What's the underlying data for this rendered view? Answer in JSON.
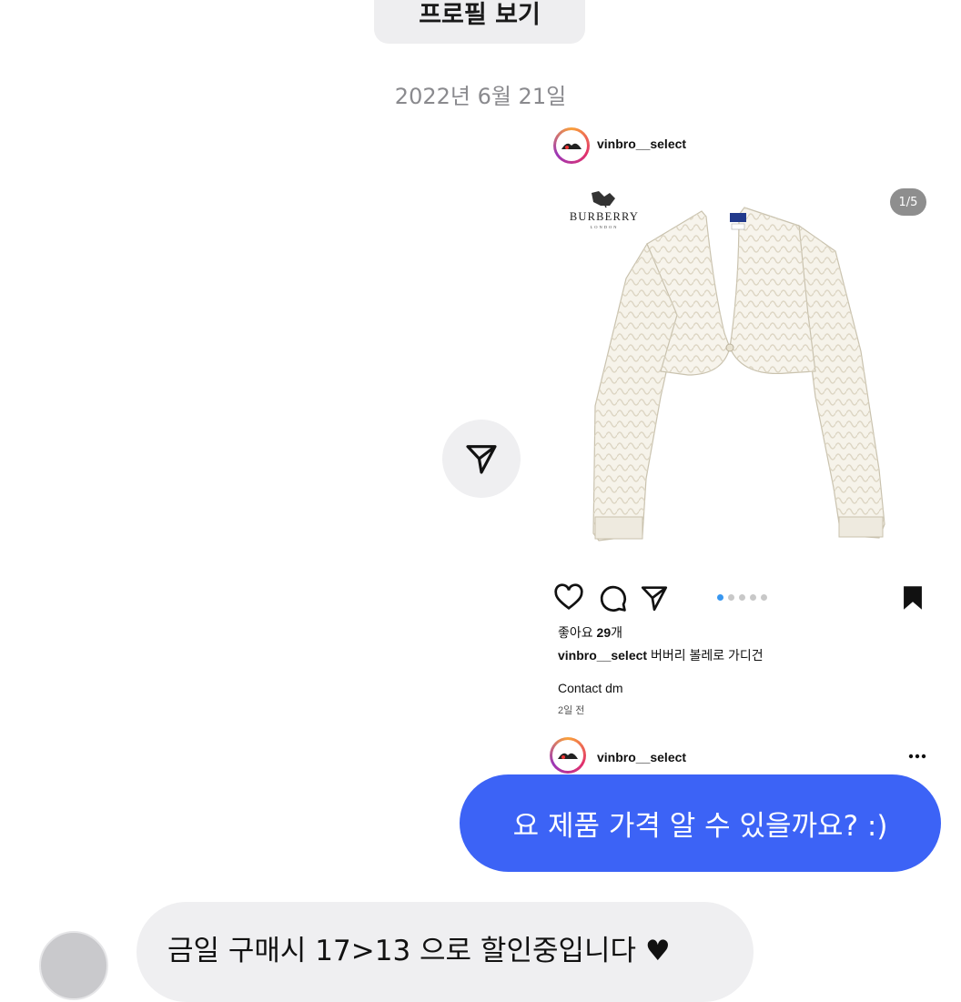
{
  "thread": {
    "profile_button": "프로필 보기",
    "date_separator": "2022년 6월 21일"
  },
  "shared_post": {
    "username": "vinbro__select",
    "image_counter": "1/5",
    "brand_logo_text": "BURBERRY",
    "brand_logo_subtext": "LONDON",
    "carousel_dots": 5,
    "carousel_active_index": 0,
    "likes": {
      "prefix": "좋아요 ",
      "count": "29",
      "suffix": "개"
    },
    "caption": {
      "user": "vinbro__select",
      "text": " 버버리 볼레로 가디건"
    },
    "contact": "Contact dm",
    "time_ago": "2일 전",
    "next_post_username": "vinbro__select"
  },
  "messages": [
    {
      "from": "me",
      "text": "요 제품 가격 알 수 있을까요? :)"
    },
    {
      "from": "them",
      "text": "금일 구매시 17>13 으로 할인중입니다 ♥"
    }
  ],
  "colors": {
    "my_bubble": "#3c63f6",
    "their_bubble": "#efeff1",
    "date_text": "#8a8a8e",
    "active_dot": "#3897f0"
  },
  "icons": {
    "share": "paper-plane-icon",
    "like": "heart-outline-icon",
    "comment": "comment-bubble-icon",
    "send": "paper-plane-icon",
    "save": "bookmark-filled-icon",
    "more": "ellipsis-icon",
    "reaction": "heart-filled"
  }
}
